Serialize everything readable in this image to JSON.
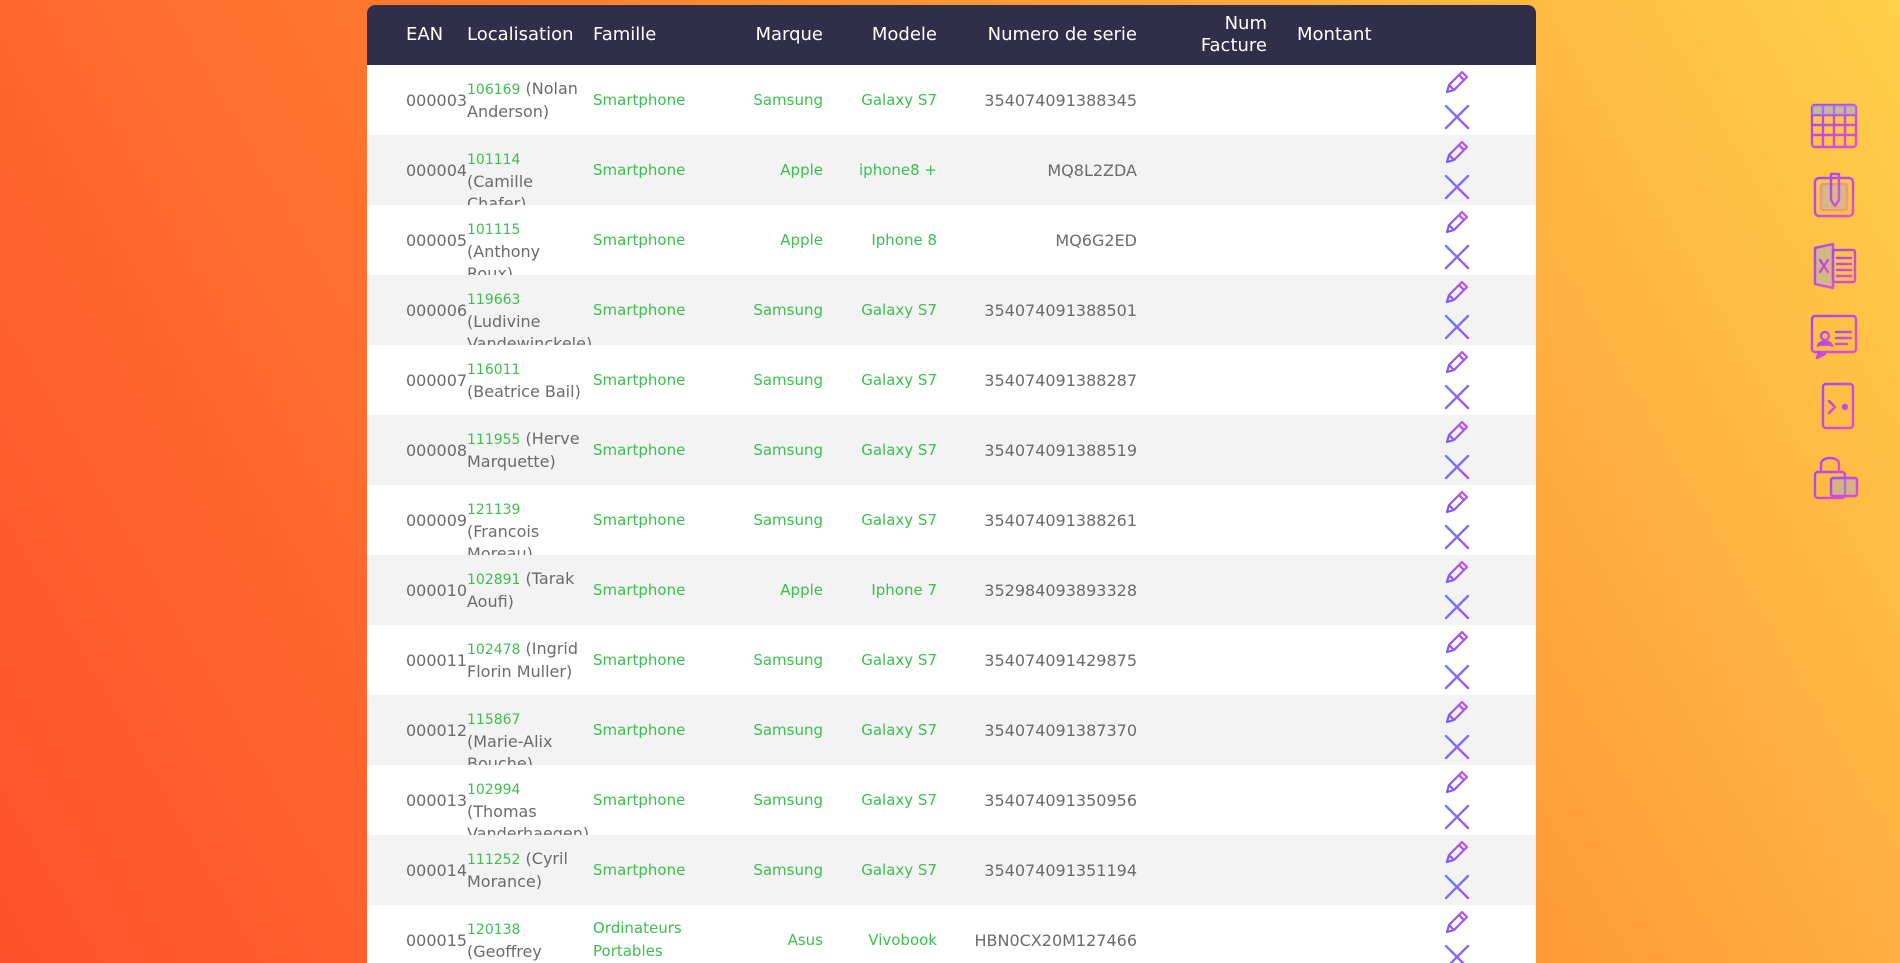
{
  "table": {
    "headers": {
      "ean": "EAN",
      "localisation": "Localisation",
      "famille": "Famille",
      "marque": "Marque",
      "modele": "Modele",
      "serie": "Numero de serie",
      "facture": "Num Facture",
      "montant": "Montant"
    },
    "rows": [
      {
        "ean": "000003",
        "loc_id": "106169",
        "loc_name": "(Nolan Anderson)",
        "famille": "Smartphone",
        "marque": "Samsung",
        "modele": "Galaxy S7",
        "serie": "354074091388345",
        "facture": "",
        "montant": ""
      },
      {
        "ean": "000004",
        "loc_id": "101114",
        "loc_name": "(Camille Chafer)",
        "famille": "Smartphone",
        "marque": "Apple",
        "modele": "iphone8 +",
        "serie": "MQ8L2ZDA",
        "facture": "",
        "montant": ""
      },
      {
        "ean": "000005",
        "loc_id": "101115",
        "loc_name": "(Anthony Roux)",
        "famille": "Smartphone",
        "marque": "Apple",
        "modele": "Iphone 8",
        "serie": "MQ6G2ED",
        "facture": "",
        "montant": ""
      },
      {
        "ean": "000006",
        "loc_id": "119663",
        "loc_name": "(Ludivine Vandewinckele)",
        "famille": "Smartphone",
        "marque": "Samsung",
        "modele": "Galaxy S7",
        "serie": "354074091388501",
        "facture": "",
        "montant": ""
      },
      {
        "ean": "000007",
        "loc_id": "116011",
        "loc_name": "(Beatrice Bail)",
        "famille": "Smartphone",
        "marque": "Samsung",
        "modele": "Galaxy S7",
        "serie": "354074091388287",
        "facture": "",
        "montant": ""
      },
      {
        "ean": "000008",
        "loc_id": "111955",
        "loc_name": "(Herve Marquette)",
        "famille": "Smartphone",
        "marque": "Samsung",
        "modele": "Galaxy S7",
        "serie": "354074091388519",
        "facture": "",
        "montant": ""
      },
      {
        "ean": "000009",
        "loc_id": "121139",
        "loc_name": "(Francois Moreau)",
        "famille": "Smartphone",
        "marque": "Samsung",
        "modele": "Galaxy S7",
        "serie": "354074091388261",
        "facture": "",
        "montant": ""
      },
      {
        "ean": "000010",
        "loc_id": "102891",
        "loc_name": "(Tarak Aoufi)",
        "famille": "Smartphone",
        "marque": "Apple",
        "modele": "Iphone 7",
        "serie": "352984093893328",
        "facture": "",
        "montant": ""
      },
      {
        "ean": "000011",
        "loc_id": "102478",
        "loc_name": "(Ingrid Florin Muller)",
        "famille": "Smartphone",
        "marque": "Samsung",
        "modele": "Galaxy S7",
        "serie": "354074091429875",
        "facture": "",
        "montant": ""
      },
      {
        "ean": "000012",
        "loc_id": "115867",
        "loc_name": "(Marie-Alix Bouche)",
        "famille": "Smartphone",
        "marque": "Samsung",
        "modele": "Galaxy S7",
        "serie": "354074091387370",
        "facture": "",
        "montant": ""
      },
      {
        "ean": "000013",
        "loc_id": "102994",
        "loc_name": "(Thomas Vanderhaegen)",
        "famille": "Smartphone",
        "marque": "Samsung",
        "modele": "Galaxy S7",
        "serie": "354074091350956",
        "facture": "",
        "montant": ""
      },
      {
        "ean": "000014",
        "loc_id": "111252",
        "loc_name": "(Cyril Morance)",
        "famille": "Smartphone",
        "marque": "Samsung",
        "modele": "Galaxy S7",
        "serie": "354074091351194",
        "facture": "",
        "montant": ""
      },
      {
        "ean": "000015",
        "loc_id": "120138",
        "loc_name": "(Geoffrey Wood)",
        "famille": "Ordinateurs Portables",
        "marque": "Asus",
        "modele": "Vivobook",
        "serie": "HBN0CX20M127466",
        "facture": "",
        "montant": ""
      }
    ],
    "row_actions": {
      "edit_icon": "pencil-icon",
      "delete_icon": "close-icon"
    }
  },
  "side_menu": [
    {
      "icon": "grid-table-icon"
    },
    {
      "icon": "clipboard-edit-icon"
    },
    {
      "icon": "excel-document-icon"
    },
    {
      "icon": "user-card-icon"
    },
    {
      "icon": "logout-door-icon"
    },
    {
      "icon": "lock-card-icon"
    }
  ],
  "colors": {
    "header_bg": "#312e4a",
    "accent_green": "#3cbf4f",
    "icon_purple": "#a04cf0",
    "icon_blue": "#4f7dff",
    "icon_pink": "#e64bd0"
  }
}
